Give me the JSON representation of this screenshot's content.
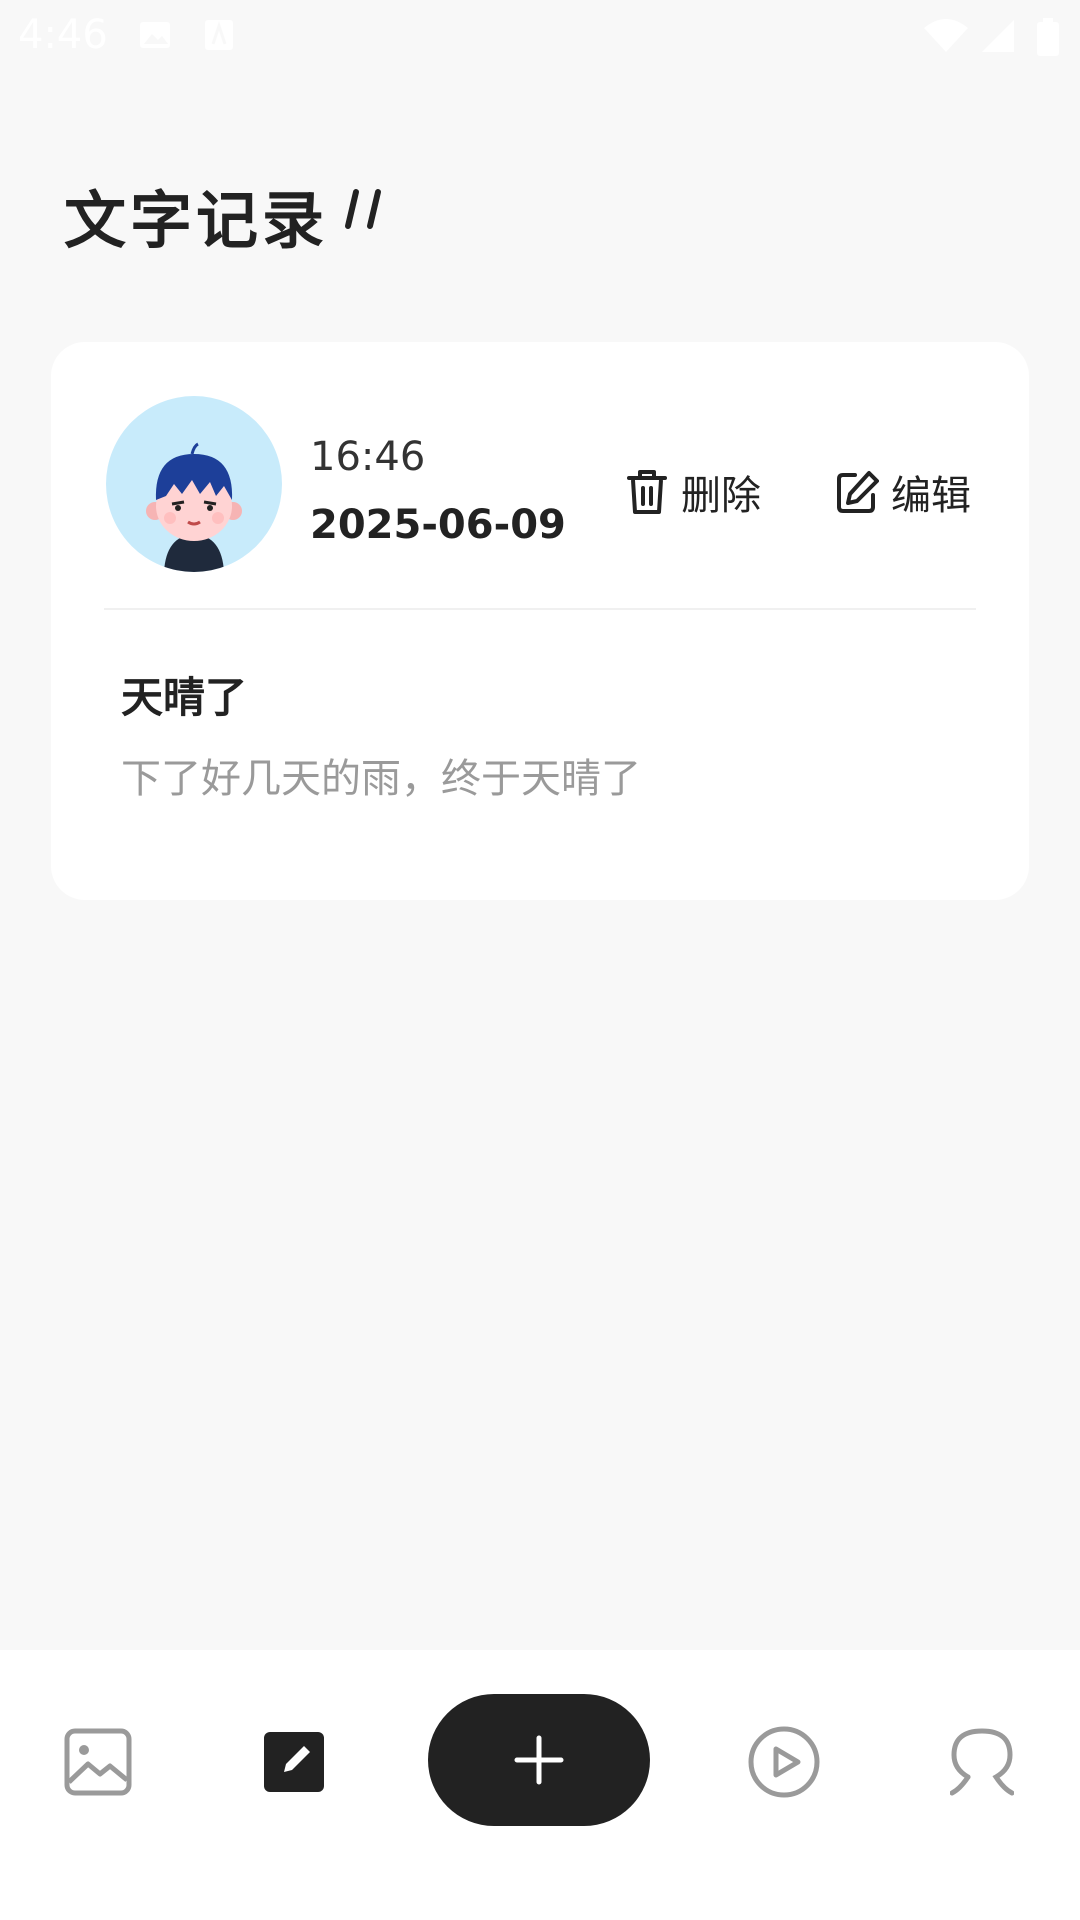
{
  "status_bar": {
    "time": "4:46",
    "icons": [
      "image-notification-icon",
      "a-notification-icon",
      "wifi-icon",
      "signal-icon",
      "battery-icon"
    ]
  },
  "page": {
    "title": "文字记录"
  },
  "record": {
    "time": "16:46",
    "date": "2025-06-09",
    "delete_label": "删除",
    "edit_label": "编辑",
    "title": "天晴了",
    "content": "下了好几天的雨，终于天晴了"
  },
  "bottom_nav": {
    "items": [
      {
        "icon": "gallery-icon",
        "active": false
      },
      {
        "icon": "text-edit-icon",
        "active": true
      },
      {
        "icon": "add-icon"
      },
      {
        "icon": "video-play-icon",
        "active": false
      },
      {
        "icon": "profile-icon",
        "active": false
      }
    ]
  },
  "colors": {
    "background": "#f8f8f8",
    "card": "#ffffff",
    "primary_dark": "#222222",
    "muted_text": "#9a9a9a",
    "avatar_bg": "#c8ebfb",
    "inactive_icon": "#9a9a9a"
  }
}
